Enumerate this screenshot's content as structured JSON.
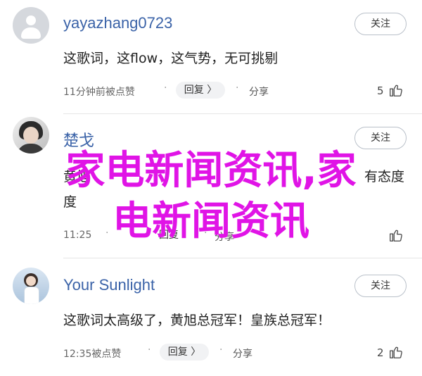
{
  "comments": [
    {
      "username": "yayazhang0723",
      "follow_label": "关注",
      "text": "这歌词，这flow，这气势，无可挑剔",
      "time": "11分钟前被点赞",
      "reply_label": "回复 〉",
      "share_label": "分享",
      "likes": "5",
      "avatar_icon": "default-avatar-icon"
    },
    {
      "username": "楚戈",
      "follow_label": "关注",
      "text": "黄旭",
      "text_rest": "有态度",
      "time": "11:25",
      "reply_label": "回复",
      "share_label": "分享",
      "likes": "",
      "avatar_icon": "user-photo-avatar"
    },
    {
      "username": "Your Sunlight",
      "follow_label": "关注",
      "text": "这歌词太高级了，黄旭总冠军！皇族总冠军！",
      "time": "12:35被点赞",
      "reply_label": "回复 〉",
      "share_label": "分享",
      "likes": "2",
      "avatar_icon": "user-photo-avatar"
    }
  ],
  "watermark": {
    "line1": "家电新闻资讯,家",
    "line2": "电新闻资讯"
  },
  "colors": {
    "username": "#3b63a8",
    "watermark": "#e014e6"
  }
}
